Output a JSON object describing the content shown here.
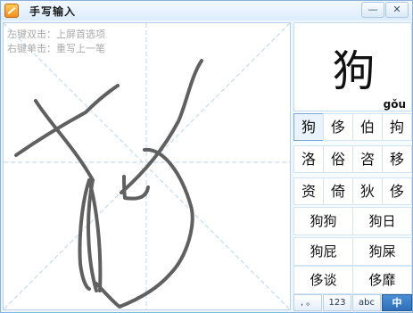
{
  "window": {
    "title": "手写输入",
    "minimize_label": "—",
    "close_label": "✕"
  },
  "canvas": {
    "hint_left": "左键双击：上屏首选项",
    "hint_right": "右键单击：重写上一笔"
  },
  "preview": {
    "character": "狗",
    "pinyin": "gǒu"
  },
  "candidates": {
    "singles": [
      "狗",
      "侈",
      "伯",
      "拘",
      "洛",
      "俗",
      "咨",
      "移",
      "资",
      "倚",
      "狄",
      "侈"
    ],
    "doubles": [
      "狗狗",
      "狗日",
      "狗屁",
      "狗屎",
      "侈谈",
      "侈靡"
    ]
  },
  "modes": {
    "punct": ", 。",
    "digits": "123",
    "letters": "abc",
    "chinese": "中"
  },
  "colors": {
    "stroke": "#606060",
    "guide": "#b8d6ee",
    "accent": "#2f6fb8"
  }
}
